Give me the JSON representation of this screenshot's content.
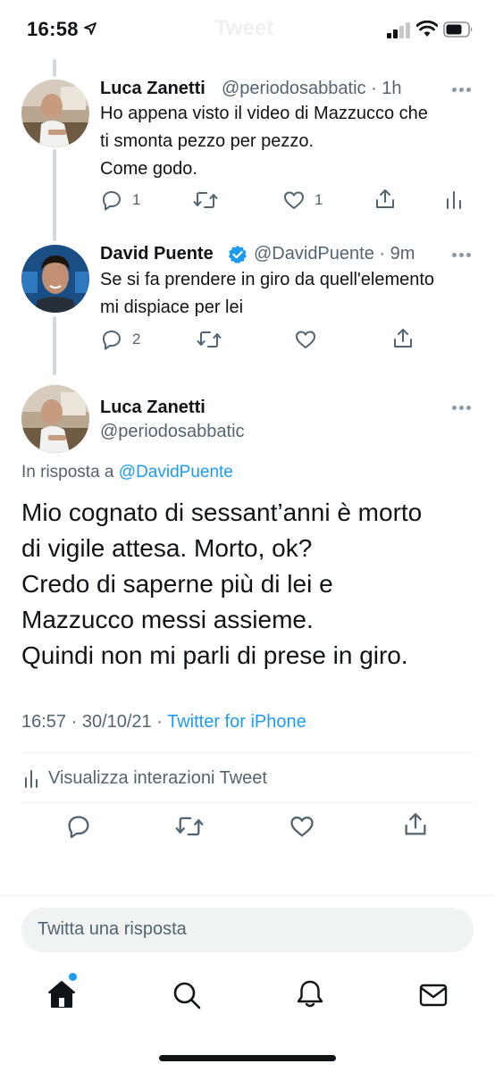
{
  "status_bar": {
    "time": "16:58",
    "ghost_title": "Tweet"
  },
  "tweets": [
    {
      "name": "Luca Zanetti",
      "handle": "@periodosabbatic",
      "time": "1h",
      "text": "Ho appena visto il video di Mazzucco che\nti smonta pezzo per pezzo.\nCome godo.",
      "replies": "1",
      "likes": "1"
    },
    {
      "name": "David Puente",
      "handle": "@DavidPuente",
      "time": "9m",
      "verified": true,
      "text": "Se si fa prendere in giro da quell'elemento\nmi dispiace per lei",
      "replies": "2"
    }
  ],
  "main_tweet": {
    "name": "Luca Zanetti",
    "handle": "@periodosabbatic",
    "reply_prefix": "In risposta a ",
    "reply_target": "@DavidPuente",
    "text": "Mio cognato di sessant’anni è morto\ndi vigile attesa. Morto, ok?\nCredo di saperne più di lei e\nMazzucco messi assieme.\nQuindi non mi parli di prese in giro.",
    "timestamp": "16:57 · 30/10/21 · ",
    "source": "Twitter for iPhone",
    "interactions_label": "Visualizza interazioni Tweet"
  },
  "reply_box": {
    "placeholder": "Twitta una risposta"
  },
  "tab_bar": {
    "items": [
      "home-icon",
      "search-icon",
      "bell-icon",
      "mail-icon"
    ],
    "has_notification": true
  },
  "colors": {
    "accent": "#1d9bf0",
    "text": "#0f1419",
    "secondary": "#536471",
    "thread_line": "#cfd9de"
  }
}
